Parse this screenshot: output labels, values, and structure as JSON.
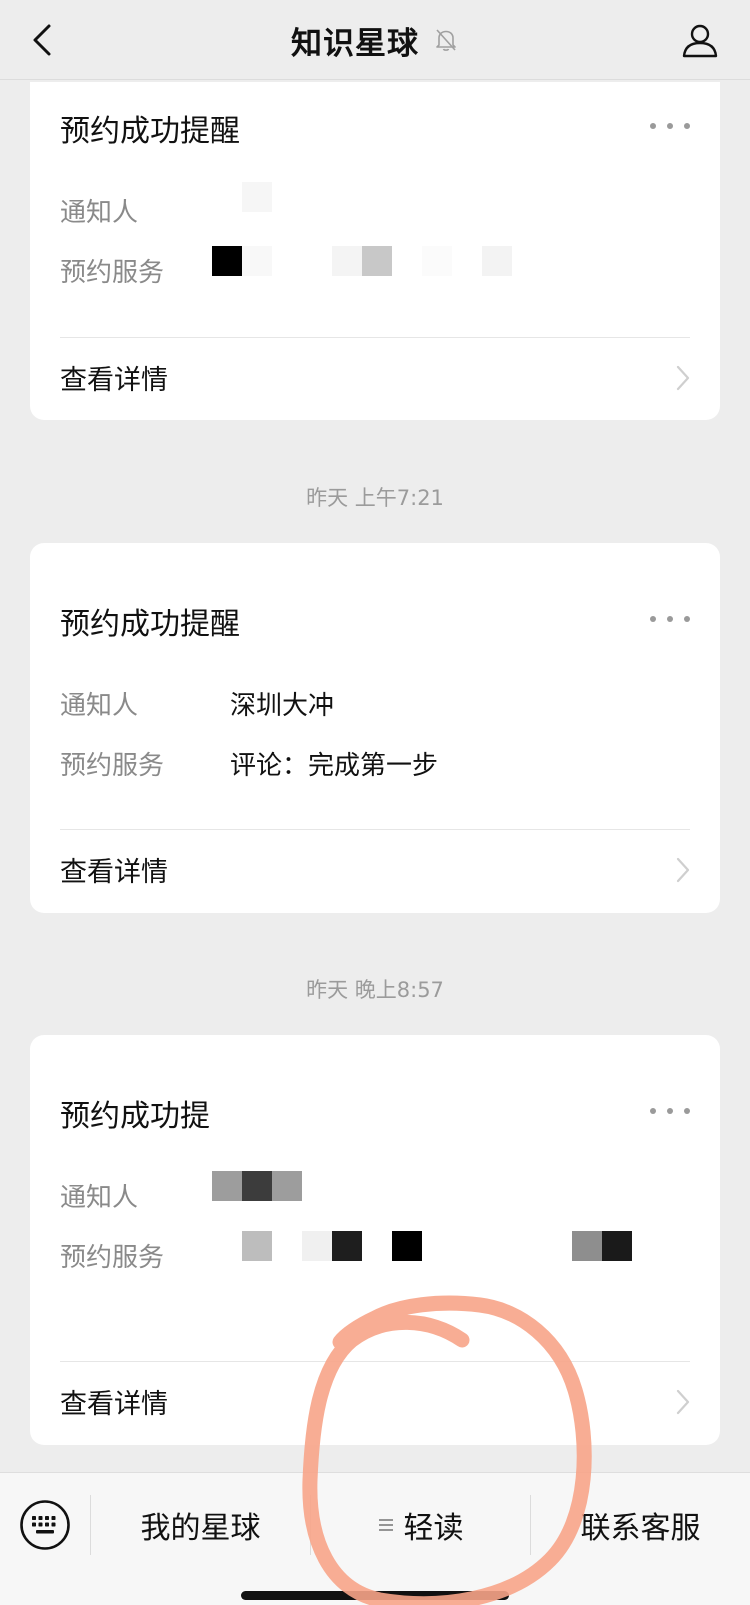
{
  "header": {
    "title": "知识星球",
    "back_icon": "chevron-left-icon",
    "mute_icon": "bell-muted-icon",
    "profile_icon": "person-icon"
  },
  "messages": [
    {
      "title": "预约成功提醒",
      "notifier_label": "通知人",
      "notifier_value": "",
      "service_label": "预约服务",
      "service_value": "",
      "detail_label": "查看详情"
    },
    {
      "timestamp": "昨天 上午7:21",
      "title": "预约成功提醒",
      "notifier_label": "通知人",
      "notifier_value": "深圳大冲",
      "service_label": "预约服务",
      "service_value": "评论：完成第一步",
      "detail_label": "查看详情"
    },
    {
      "timestamp": "昨天 晚上8:57",
      "title": "预约成功提",
      "notifier_label": "通知人",
      "notifier_value": "",
      "service_label": "预约服务",
      "service_value": "",
      "detail_label": "查看详情"
    }
  ],
  "bottom_bar": {
    "keyboard_icon": "keyboard-icon",
    "menu": [
      {
        "label": "我的星球"
      },
      {
        "label": "轻读",
        "icon": "lines-icon"
      },
      {
        "label": "联系客服"
      }
    ]
  },
  "colors": {
    "background": "#ededed",
    "card": "#ffffff",
    "label": "#8a8a8a",
    "annotation": "#f7a488"
  }
}
